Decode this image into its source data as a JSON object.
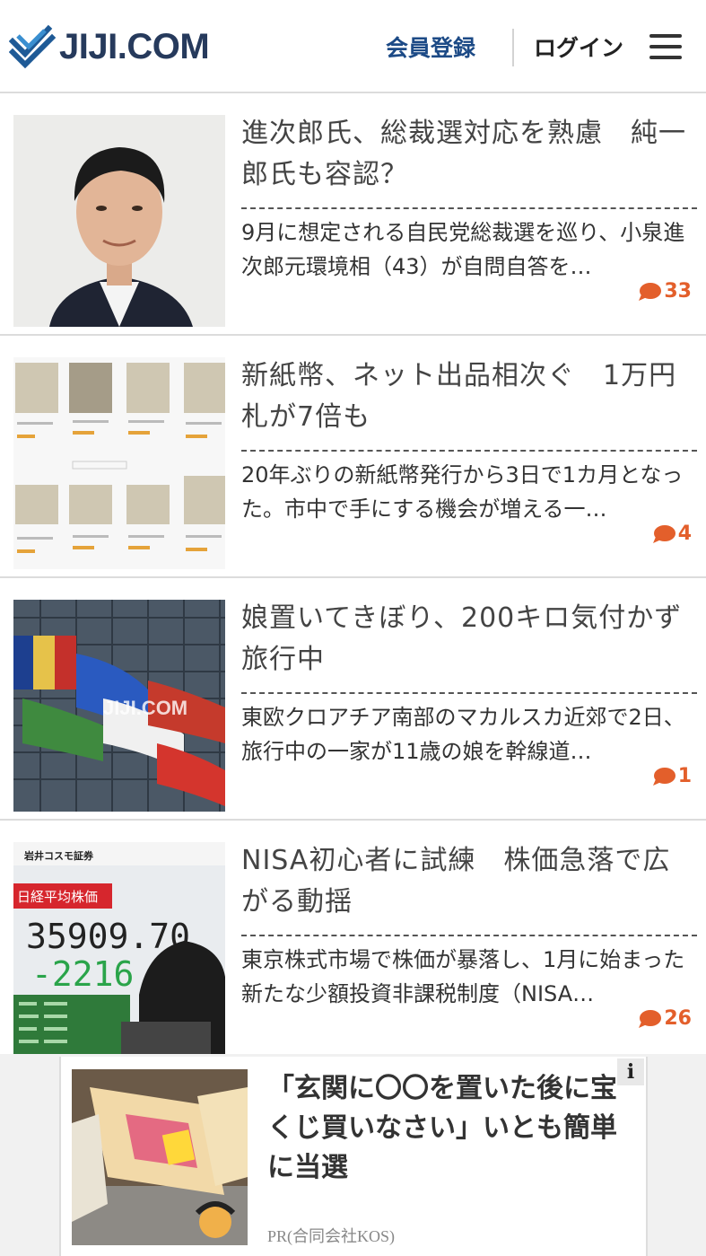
{
  "header": {
    "logo_text": "JIJI.COM",
    "register_label": "会員登録",
    "login_label": "ログイン",
    "menu_icon": "hamburger-menu-icon"
  },
  "articles": [
    {
      "title": "進次郎氏、総裁選対応を熟慮　純一郎氏も容認？",
      "summary": "9月に想定される自民党総裁選を巡り、小泉進次郎元環境相（43）が自問自答を…",
      "comments": "33",
      "image": "portrait-photo"
    },
    {
      "title": "新紙幣、ネット出品相次ぐ　1万円札が7倍も",
      "summary": "20年ぶりの新紙幣発行から3日で1カ月となった。市中で手にする機会が増える一…",
      "comments": "4",
      "image": "banknote-listings-photo"
    },
    {
      "title": "娘置いてきぼり、200キロ気付かず　旅行中",
      "summary": "東欧クロアチア南部のマカルスカ近郊で2日、旅行中の一家が11歳の娘を幹線道…",
      "comments": "1",
      "image": "eu-flags-photo",
      "watermark": "JIJI.COM"
    },
    {
      "title": "NISA初心者に試練　株価急落で広がる動揺",
      "summary": "東京株式市場で株価が暴落し、1月に始まった新たな少額投資非課税制度（NISA…",
      "comments": "26",
      "image": "stock-board-photo",
      "board": {
        "company": "岩井コスモ証券",
        "index_name": "日経平均株価",
        "value": "35909.70",
        "change": "-2216"
      }
    }
  ],
  "ad": {
    "title": "「玄関に〇〇を置いた後に宝くじ買いなさい」いとも簡単に当選",
    "sponsor": "PR(合同会社KOS)",
    "info_label": "i"
  },
  "colors": {
    "brand": "#263a5c",
    "register": "#1c4a86",
    "comment": "#e35f2b"
  }
}
